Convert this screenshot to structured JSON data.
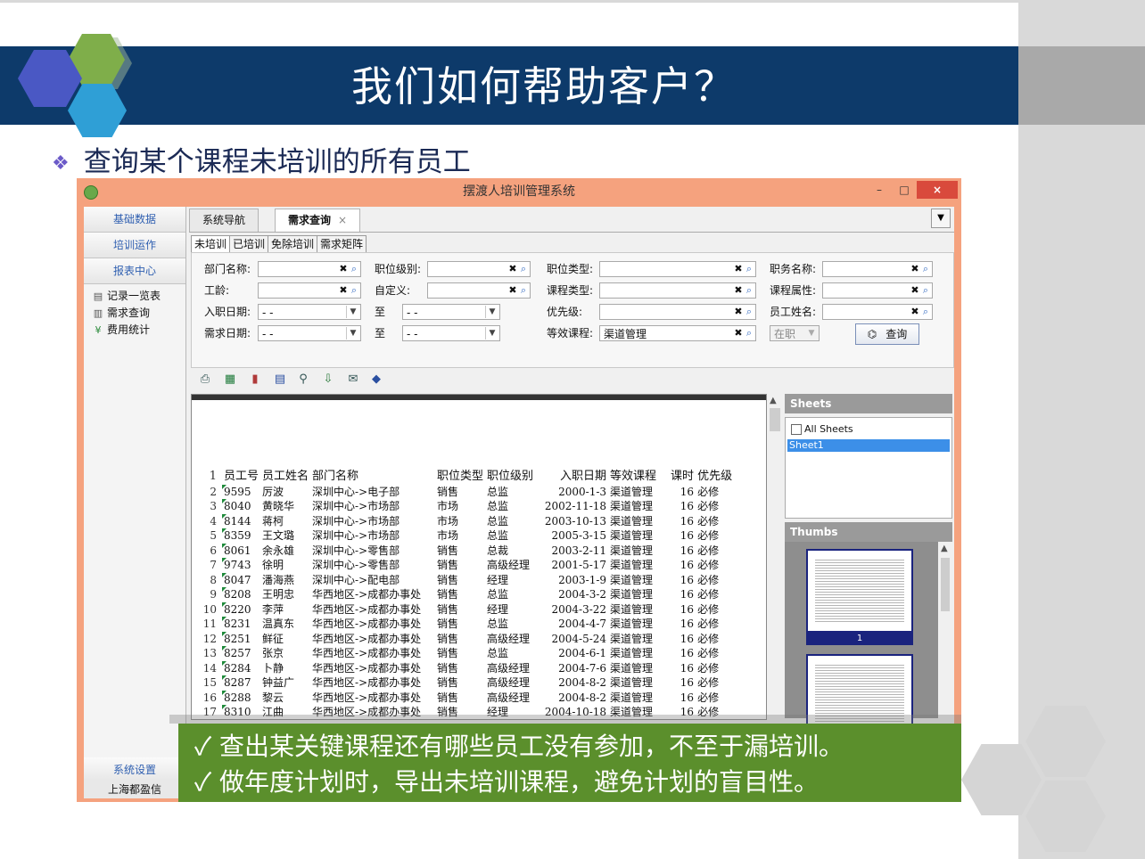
{
  "slide": {
    "title": "我们如何帮助客户？",
    "subtitle": "查询某个课程未培训的所有员工",
    "bullet_points": [
      "✓ 查出某关键课程还有哪些员工没有参加，不至于漏培训。",
      "✓ 做年度计划时，导出未培训课程，避免计划的盲目性。"
    ]
  },
  "window": {
    "title": "摆渡人培训管理系统",
    "minimize": "–",
    "maximize": "□",
    "close": "×"
  },
  "leftnav": {
    "top_items": [
      "基础数据",
      "培训运作",
      "报表中心"
    ],
    "sub_items": [
      {
        "label": "记录一览表",
        "icon": "report-icon"
      },
      {
        "label": "需求查询",
        "icon": "search-db-icon"
      },
      {
        "label": "费用统计",
        "icon": "yen-icon"
      }
    ],
    "bottom_item": "系统设置",
    "company": "上海都盈信"
  },
  "tabs": [
    {
      "label": "系统导航",
      "active": false
    },
    {
      "label": "需求查询",
      "active": true,
      "close": "×"
    }
  ],
  "subtabs": [
    "未培训",
    "已培训",
    "免除培训",
    "需求矩阵"
  ],
  "filters": {
    "dept_name": {
      "label": "部门名称:",
      "value": ""
    },
    "job_level": {
      "label": "职位级别:",
      "value": ""
    },
    "job_type": {
      "label": "职位类型:",
      "value": ""
    },
    "title_name": {
      "label": "职务名称:",
      "value": ""
    },
    "seniority": {
      "label": "工龄:",
      "value": ""
    },
    "custom": {
      "label": "自定义:",
      "value": ""
    },
    "course_type": {
      "label": "课程类型:",
      "value": ""
    },
    "course_attr": {
      "label": "课程属性:",
      "value": ""
    },
    "hire_date": {
      "label": "入职日期:",
      "from": "- -",
      "to_label": "至",
      "to": "- -"
    },
    "priority": {
      "label": "优先级:",
      "value": ""
    },
    "employee_name": {
      "label": "员工姓名:",
      "value": ""
    },
    "demand_date": {
      "label": "需求日期:",
      "from": "- -",
      "to_label": "至",
      "to": "- -"
    },
    "equiv_course": {
      "label": "等效课程:",
      "value": "渠道管理"
    },
    "status": {
      "value": "在职"
    },
    "query_button": "查询"
  },
  "toolbar": [
    "print-icon",
    "excel-icon",
    "chart-icon",
    "layout-icon",
    "zoom-icon",
    "export-icon",
    "mail-icon",
    "book-icon"
  ],
  "sheet": {
    "headers": [
      "员工号",
      "员工姓名",
      "部门名称",
      "职位类型",
      "职位级别",
      "入职日期",
      "等效课程",
      "课时",
      "优先级"
    ],
    "row_numbers": [
      "1",
      "2",
      "3",
      "4",
      "5",
      "6",
      "7",
      "8",
      "9",
      "10",
      "11",
      "12",
      "13",
      "14",
      "15",
      "16",
      "17"
    ],
    "rows": [
      [
        "9595",
        "厉波",
        "深圳中心->电子部",
        "销售",
        "总监",
        "2000-1-3",
        "渠道管理",
        "16",
        "必修"
      ],
      [
        "8040",
        "黄晓华",
        "深圳中心->市场部",
        "市场",
        "总监",
        "2002-11-18",
        "渠道管理",
        "16",
        "必修"
      ],
      [
        "8144",
        "蒋柯",
        "深圳中心->市场部",
        "市场",
        "总监",
        "2003-10-13",
        "渠道管理",
        "16",
        "必修"
      ],
      [
        "8359",
        "王文璐",
        "深圳中心->市场部",
        "市场",
        "总监",
        "2005-3-15",
        "渠道管理",
        "16",
        "必修"
      ],
      [
        "8061",
        "余永雄",
        "深圳中心->零售部",
        "销售",
        "总裁",
        "2003-2-11",
        "渠道管理",
        "16",
        "必修"
      ],
      [
        "9743",
        "徐明",
        "深圳中心->零售部",
        "销售",
        "高级经理",
        "2001-5-17",
        "渠道管理",
        "16",
        "必修"
      ],
      [
        "8047",
        "潘海燕",
        "深圳中心->配电部",
        "销售",
        "经理",
        "2003-1-9",
        "渠道管理",
        "16",
        "必修"
      ],
      [
        "8208",
        "王明忠",
        "华西地区->成都办事处",
        "销售",
        "总监",
        "2004-3-2",
        "渠道管理",
        "16",
        "必修"
      ],
      [
        "8220",
        "李萍",
        "华西地区->成都办事处",
        "销售",
        "经理",
        "2004-3-22",
        "渠道管理",
        "16",
        "必修"
      ],
      [
        "8231",
        "温真东",
        "华西地区->成都办事处",
        "销售",
        "总监",
        "2004-4-7",
        "渠道管理",
        "16",
        "必修"
      ],
      [
        "8251",
        "鲜征",
        "华西地区->成都办事处",
        "销售",
        "高级经理",
        "2004-5-24",
        "渠道管理",
        "16",
        "必修"
      ],
      [
        "8257",
        "张京",
        "华西地区->成都办事处",
        "销售",
        "总监",
        "2004-6-1",
        "渠道管理",
        "16",
        "必修"
      ],
      [
        "8284",
        "卜静",
        "华西地区->成都办事处",
        "销售",
        "高级经理",
        "2004-7-6",
        "渠道管理",
        "16",
        "必修"
      ],
      [
        "8287",
        "钟益广",
        "华西地区->成都办事处",
        "销售",
        "高级经理",
        "2004-8-2",
        "渠道管理",
        "16",
        "必修"
      ],
      [
        "8288",
        "黎云",
        "华西地区->成都办事处",
        "销售",
        "高级经理",
        "2004-8-2",
        "渠道管理",
        "16",
        "必修"
      ],
      [
        "8310",
        "江曲",
        "华西地区->成都办事处",
        "销售",
        "经理",
        "2004-10-18",
        "渠道管理",
        "16",
        "必修"
      ]
    ]
  },
  "sidepanel": {
    "sheets_title": "Sheets",
    "all_sheets": "All Sheets",
    "sheet_items": [
      "Sheet1"
    ],
    "thumbs_title": "Thumbs",
    "thumb_page": "1"
  }
}
